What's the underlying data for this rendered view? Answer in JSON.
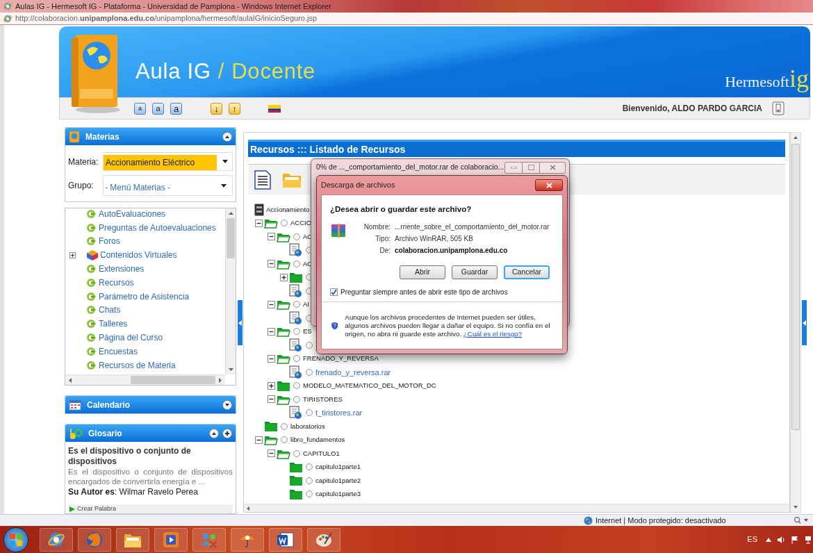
{
  "browser": {
    "title": "Aulas IG - Hermesoft IG - Plataforma - Universidad de Pamplona - Windows Internet Explorer",
    "address": "http://colaboracion.**unipamplona.edu.co**/unipamplona/hermesoft/aulaIG/inicioSeguro.jsp"
  },
  "header": {
    "app_name": "Aula IG",
    "separator": "/",
    "role": "Docente",
    "brand": "Hermesoft",
    "brand_suffix": "ig",
    "font_buttons": [
      "a",
      "a",
      "a"
    ],
    "order_buttons": [
      "↓",
      "↑"
    ],
    "welcome": "Bienvenido, ALDO PARDO GARCIA"
  },
  "materias": {
    "title": "Materias",
    "expanded": true,
    "materia_label": "Materia:",
    "materia_value": "Accionamiento Eléctrico",
    "grupo_label": "Grupo:",
    "grupo_value": "- Menú Materias -",
    "menu": [
      {
        "label": "AutoEvaluaciones",
        "kind": "link"
      },
      {
        "label": "Preguntas de Autoevaluaciones",
        "kind": "link"
      },
      {
        "label": "Foros",
        "kind": "link"
      },
      {
        "label": "Contenidos Virtuales",
        "kind": "group"
      },
      {
        "label": "Extensiones",
        "kind": "link"
      },
      {
        "label": "Recursos",
        "kind": "link"
      },
      {
        "label": "Parámetro de Asistencia",
        "kind": "link"
      },
      {
        "label": "Chats",
        "kind": "link"
      },
      {
        "label": "Talleres",
        "kind": "link"
      },
      {
        "label": "Página del Curso",
        "kind": "link"
      },
      {
        "label": "Encuestas",
        "kind": "link"
      },
      {
        "label": "Recursos de Materia",
        "kind": "link"
      }
    ]
  },
  "calendario": {
    "title": "Calendario",
    "expanded": false
  },
  "glosario": {
    "title": "Glosario",
    "expanded": true,
    "term": "Es el dispositivo o conjunto de dispositivos",
    "definition": "Es el dispositivo o conjunto de dispositivos encargados de convertirla energía e ...",
    "author": "**Su Autor es**: Wilmar Ravelo Perea",
    "create": "Crear Palabra"
  },
  "resources": {
    "title": "Recursos ::: Listado de Recursos",
    "tree": [
      {
        "label": "Accionamiento",
        "kind": "drive",
        "children": [
          {
            "label": "ACCIO",
            "kind": "folder",
            "checked": false,
            "expanded": true,
            "children": [
              {
                "label": "AC",
                "kind": "folder",
                "checked": false,
                "expanded": true,
                "children": [
                  {
                    "kind": "file",
                    "checked": false
                  }
                ]
              },
              {
                "label": "AC",
                "kind": "folder",
                "checked": false,
                "expanded": true,
                "children": [
                  {
                    "kind": "folder",
                    "checked": false,
                    "expanded": false
                  },
                  {
                    "kind": "file",
                    "checked": false
                  }
                ]
              },
              {
                "label": "AI",
                "kind": "folder",
                "checked": false,
                "expanded": true,
                "children": [
                  {
                    "kind": "file",
                    "checked": false
                  }
                ]
              },
              {
                "label": "ES",
                "kind": "folder",
                "checked": false,
                "expanded": true,
                "children": [
                  {
                    "kind": "file",
                    "checked": false
                  }
                ]
              },
              {
                "label": "FRENADO_Y_REVERSA",
                "kind": "folder",
                "checked": false,
                "expanded": true,
                "children": [
                  {
                    "label": "frenado_y_reversa.rar",
                    "kind": "file",
                    "checked": false
                  }
                ]
              },
              {
                "label": "MODELO_MATEMATICO_DEL_MOTOR_DC",
                "kind": "folder",
                "checked": false,
                "expanded": false
              },
              {
                "label": "TIRISTORES",
                "kind": "folder",
                "checked": false,
                "expanded": true,
                "children": [
                  {
                    "label": "t_tiristores.rar",
                    "kind": "file",
                    "checked": false
                  }
                ]
              }
            ]
          },
          {
            "label": "laboratorios",
            "kind": "folder",
            "checked": false
          },
          {
            "label": "libro_fundamentos",
            "kind": "folder",
            "checked": false,
            "expanded": true,
            "children": [
              {
                "label": "CAPITULO1",
                "kind": "folder",
                "checked": false,
                "expanded": true,
                "children": [
                  {
                    "label": "capitulo1parte1",
                    "kind": "folder",
                    "checked": false
                  },
                  {
                    "label": "capitulo1parte2",
                    "kind": "folder",
                    "checked": false
                  },
                  {
                    "label": "capitulo1parte3",
                    "kind": "folder",
                    "checked": false
                  }
                ]
              }
            ]
          }
        ]
      }
    ]
  },
  "download_window": {
    "title": "0% de ..._comportamiento_del_motor.rar de colaboracio..."
  },
  "download_dialog": {
    "title": "Descarga de archivos",
    "question": "¿Desea abrir o guardar este archivo?",
    "fields": [
      {
        "label": "Nombre:",
        "value": "...rriente_sobre_el_comportamiento_del_motor.rar",
        "bold": false
      },
      {
        "label": "Tipo:",
        "value": "Archivo WinRAR, 505 KB",
        "bold": false
      },
      {
        "label": "De:",
        "value": "colaboracion.unipamplona.edu.co",
        "bold": true
      }
    ],
    "buttons": [
      {
        "label": "Abrir",
        "focused": false
      },
      {
        "label": "Guardar",
        "focused": false
      },
      {
        "label": "Cancelar",
        "focused": true
      }
    ],
    "always_ask": {
      "label": "Preguntar siempre antes de abrir este tipo de archivos",
      "checked": true
    },
    "warning": "Aunque los archivos procedentes de Internet pueden ser útiles, algunos archivos pueden llegar a dañar el equipo. Si no confía en el origen, no abra ni guarde este archivo.",
    "risk_link": "¿Cuál es el riesgo?"
  },
  "status": {
    "zone": "Internet | Modo protegido: desactivado"
  },
  "taskbar": {
    "apps": [
      {
        "kind": "ie"
      },
      {
        "kind": "firefox"
      },
      {
        "kind": "explorer"
      },
      {
        "kind": "media"
      },
      {
        "kind": "people"
      },
      {
        "kind": "antivirus"
      },
      {
        "kind": "word"
      },
      {
        "kind": "paint"
      }
    ],
    "language": "ES"
  }
}
